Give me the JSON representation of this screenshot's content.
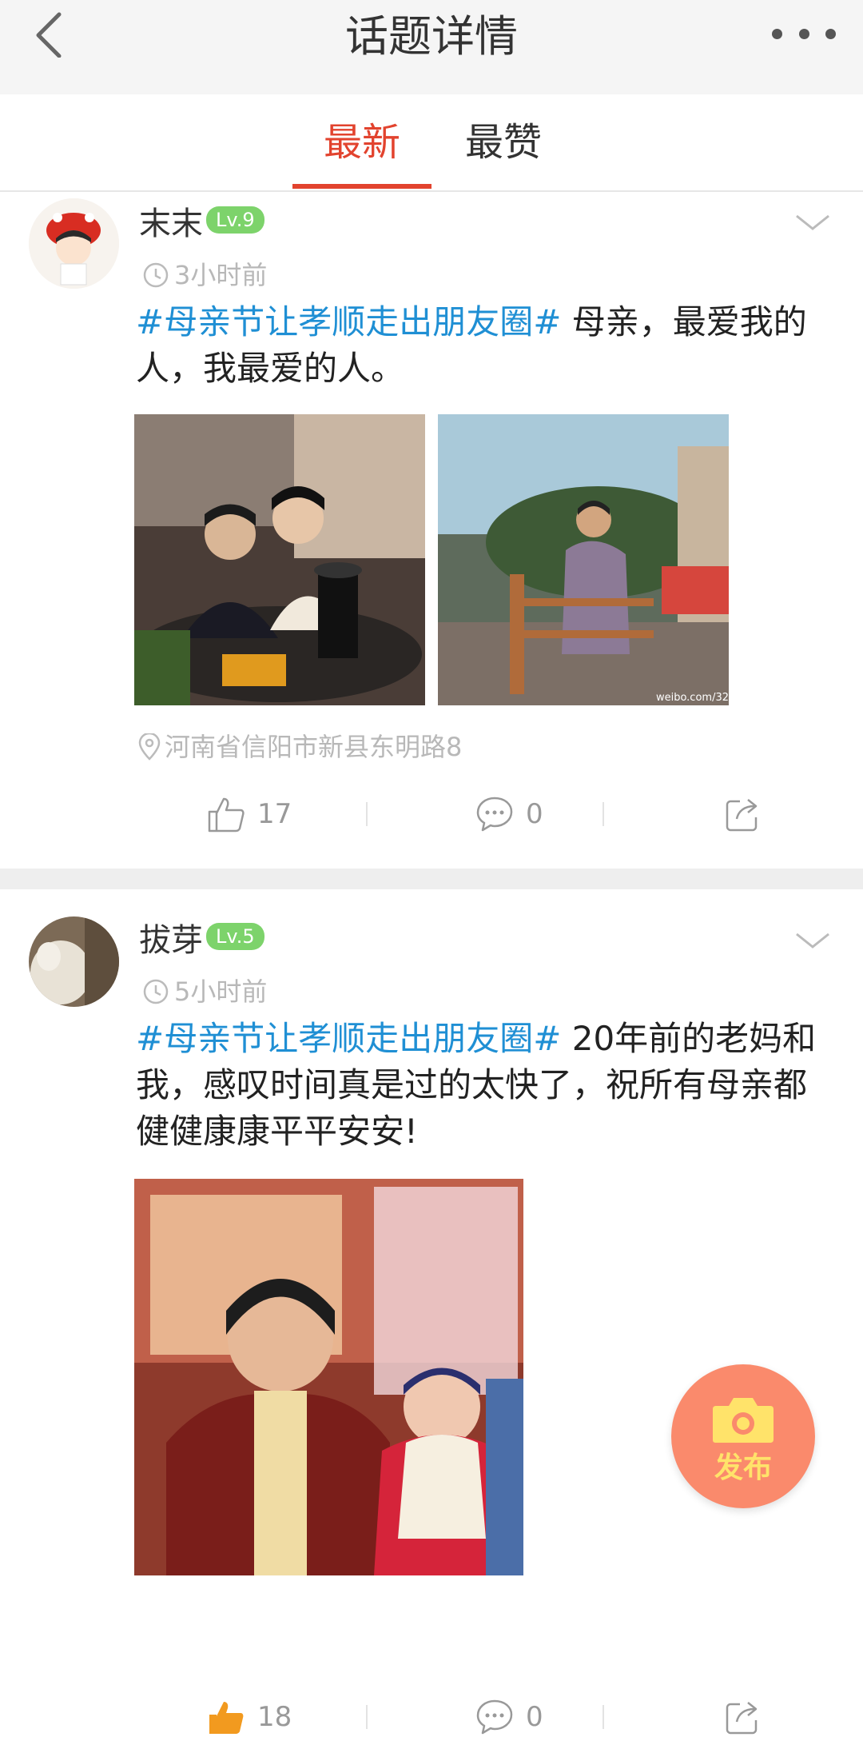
{
  "header": {
    "title": "话题详情"
  },
  "tabs": [
    {
      "label": "最新",
      "active": true
    },
    {
      "label": "最赞",
      "active": false
    }
  ],
  "posts": [
    {
      "username": "末末",
      "level": "Lv.9",
      "time": "3小时前",
      "hashtag": "#母亲节让孝顺走出朋友圈#",
      "text": " 母亲，最爱我的人，我最爱的人。",
      "location": "河南省信阳市新县东明路8",
      "likes": "17",
      "comments": "0",
      "image_watermark": "weibo.com/32"
    },
    {
      "username": "拔芽",
      "level": "Lv.5",
      "time": "5小时前",
      "hashtag": "#母亲节让孝顺走出朋友圈#",
      "text": " 20年前的老妈和我，感叹时间真是过的太快了，祝所有母亲都健健康康平平安安!",
      "likes": "18",
      "comments": "0"
    }
  ],
  "fab": {
    "label": "发布"
  },
  "colors": {
    "accent": "#e2432e",
    "hashtag": "#1f8fd4",
    "level_badge": "#7dd36b",
    "fab": "#fa8a6c"
  }
}
